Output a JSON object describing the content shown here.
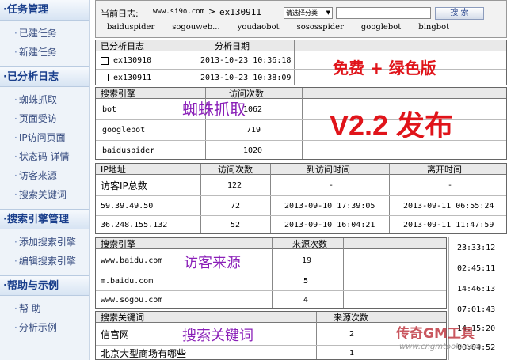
{
  "sidebar": {
    "sections": [
      {
        "title": "任务管理",
        "items": [
          "已建任务",
          "新建任务"
        ]
      },
      {
        "title": "已分析日志",
        "items": [
          "蜘蛛抓取",
          "页面受访",
          "IP访问页面",
          "状态码  详情",
          "访客来源",
          "搜索关键词"
        ]
      },
      {
        "title": "搜索引擎管理",
        "items": [
          "添加搜索引擎",
          "编辑搜索引擎"
        ]
      },
      {
        "title": "帮助与示例",
        "items": [
          "帮  助",
          "分析示例"
        ]
      }
    ]
  },
  "toolbar": {
    "current_label": "当前日志:",
    "site": "www.si9o.com",
    "arrow": ">",
    "log": "ex130911",
    "select_value": "请选择分类",
    "search_value": "",
    "search_button": "搜 索",
    "bots": [
      "baiduspider",
      "sogouweb...",
      "youdaobot",
      "sososspider",
      "googlebot",
      "bingbot"
    ]
  },
  "analyzed_logs": {
    "headers": [
      "已分析日志",
      "分析日期"
    ],
    "rows": [
      {
        "name": "ex130910",
        "date": "2013-10-23 10:36:18"
      },
      {
        "name": "ex130911",
        "date": "2013-10-23 10:38:09"
      }
    ]
  },
  "spider_table": {
    "headers": [
      "搜索引擎",
      "访问次数"
    ],
    "rows": [
      {
        "engine": "bot",
        "count": "1062"
      },
      {
        "engine": "googlebot",
        "count": "719"
      },
      {
        "engine": "baiduspider",
        "count": "1020"
      }
    ]
  },
  "ip_table": {
    "headers": [
      "IP地址",
      "访问次数",
      "到访问时间",
      "离开时间"
    ],
    "rows": [
      {
        "ip": "访客IP总数",
        "count": "122",
        "arrive": "-",
        "leave": "-"
      },
      {
        "ip": "59.39.49.50",
        "count": "72",
        "arrive": "2013-09-10  17:39:05",
        "leave": "2013-09-11  06:55:24"
      },
      {
        "ip": "36.248.155.132",
        "count": "52",
        "arrive": "2013-09-10  16:04:21",
        "leave": "2013-09-11  11:47:59"
      }
    ]
  },
  "referer_table": {
    "headers": [
      "搜索引擎",
      "来源次数"
    ],
    "rows": [
      {
        "engine": "www.baidu.com",
        "count": "19"
      },
      {
        "engine": "m.baidu.com",
        "count": "5"
      },
      {
        "engine": "www.sogou.com",
        "count": "4"
      }
    ]
  },
  "keyword_table": {
    "headers": [
      "搜索关键词",
      "来源次数"
    ],
    "rows": [
      {
        "keyword": "信宫网",
        "count": "2"
      },
      {
        "keyword": "北京大型商场有哪些",
        "count": "1"
      }
    ]
  },
  "peek_times": [
    "23:33:12",
    "02:45:11",
    "14:46:13",
    "07:01:43",
    "14:15:20",
    "00:04:52"
  ],
  "overlays": {
    "free": "免费 + 绿色版",
    "version": "V2.2 发布",
    "spider": "蜘蛛抓取",
    "visitor": "访客来源",
    "keywords": "搜索关键词"
  },
  "watermark": {
    "line1": "传奇GM工具",
    "line2": "www.cngmtools.com"
  },
  "colors": {
    "red_text": "#e0141a",
    "purple_text": "#8a1fb8",
    "nav_text": "#1a3f8c"
  }
}
